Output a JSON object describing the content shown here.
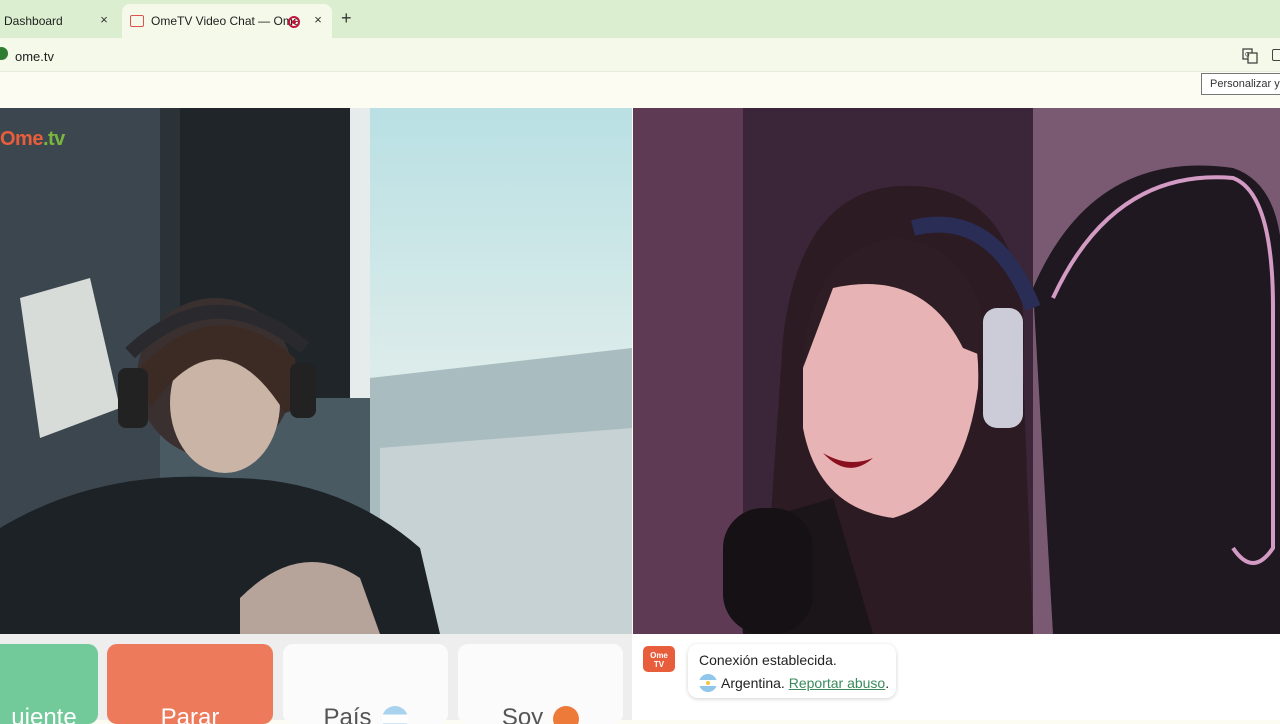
{
  "browser": {
    "tabs": [
      {
        "label": "Dashboard",
        "active": false
      },
      {
        "label": "OmeTV Video Chat — Ome",
        "active": true
      }
    ],
    "new_tab_symbol": "+",
    "close_symbol": "×",
    "url": "ome.tv",
    "tooltip": "Personalizar y c"
  },
  "video": {
    "watermark_ome": "Ome",
    "watermark_tv": ".tv"
  },
  "controls": {
    "next_label": "uiente",
    "stop_label": "Parar",
    "country_label": "País",
    "gender_label": "Soy"
  },
  "chat": {
    "logo_top": "Ome",
    "logo_bottom": "TV",
    "status_message": "Conexión establecida.",
    "country": "Argentina.",
    "report_link": "Reportar abuso",
    "report_suffix": "."
  },
  "colors": {
    "next": "#72c99a",
    "stop": "#ee7a5c",
    "link": "#3a8a5c",
    "brand_orange": "#e85d3b",
    "brand_green": "#7ab63d"
  }
}
